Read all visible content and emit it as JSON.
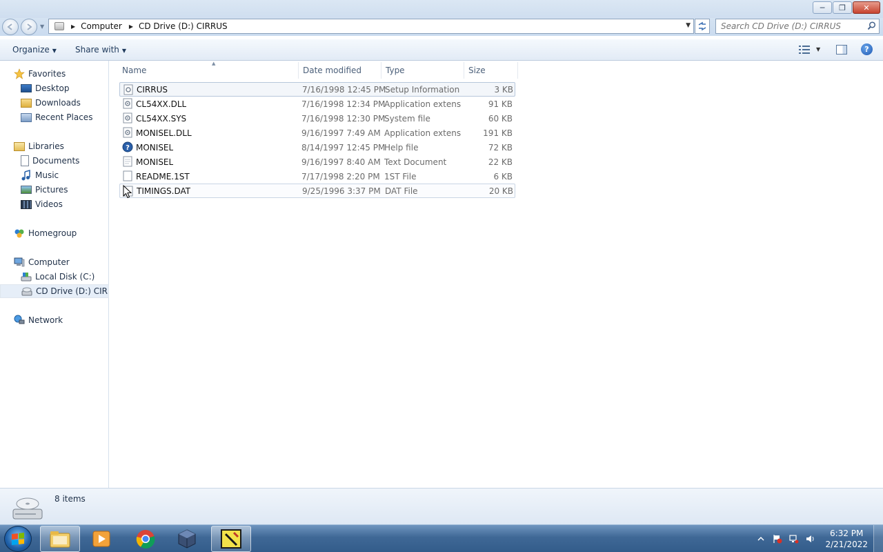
{
  "window": {
    "controls": {
      "minimize": "─",
      "maximize": "❐",
      "close": "✕"
    }
  },
  "address": {
    "crumbs": [
      "Computer",
      "CD Drive (D:) CIRRUS"
    ],
    "search_placeholder": "Search CD Drive (D:) CIRRUS"
  },
  "toolbar": {
    "organize_label": "Organize",
    "share_label": "Share with",
    "help_label": "?"
  },
  "navpane": {
    "favorites": {
      "label": "Favorites",
      "items": [
        "Desktop",
        "Downloads",
        "Recent Places"
      ]
    },
    "libraries": {
      "label": "Libraries",
      "items": [
        "Documents",
        "Music",
        "Pictures",
        "Videos"
      ]
    },
    "homegroup": {
      "label": "Homegroup"
    },
    "computer": {
      "label": "Computer",
      "items": [
        "Local Disk (C:)",
        "CD Drive (D:) CIRRUS"
      ]
    },
    "network": {
      "label": "Network"
    }
  },
  "columns": {
    "name": "Name",
    "date": "Date modified",
    "type": "Type",
    "size": "Size"
  },
  "files": [
    {
      "name": "CIRRUS",
      "date": "7/16/1998 12:45 PM",
      "type": "Setup Information",
      "size": "3 KB",
      "icon": "setup-info-icon"
    },
    {
      "name": "CL54XX.DLL",
      "date": "7/16/1998 12:34 PM",
      "type": "Application extens...",
      "size": "91 KB",
      "icon": "dll-icon"
    },
    {
      "name": "CL54XX.SYS",
      "date": "7/16/1998 12:30 PM",
      "type": "System file",
      "size": "60 KB",
      "icon": "sys-file-icon"
    },
    {
      "name": "MONISEL.DLL",
      "date": "9/16/1997 7:49 AM",
      "type": "Application extens...",
      "size": "191 KB",
      "icon": "dll-icon"
    },
    {
      "name": "MONISEL",
      "date": "8/14/1997 12:45 PM",
      "type": "Help file",
      "size": "72 KB",
      "icon": "help-file-icon"
    },
    {
      "name": "MONISEL",
      "date": "9/16/1997 8:40 AM",
      "type": "Text Document",
      "size": "22 KB",
      "icon": "text-file-icon"
    },
    {
      "name": "README.1ST",
      "date": "7/17/1998 2:20 PM",
      "type": "1ST File",
      "size": "6 KB",
      "icon": "generic-file-icon"
    },
    {
      "name": "TIMINGS.DAT",
      "date": "9/25/1996 3:37 PM",
      "type": "DAT File",
      "size": "20 KB",
      "icon": "generic-file-icon"
    }
  ],
  "status": {
    "items_text": "8 items"
  },
  "taskbar": {
    "clock_time": "6:32 PM",
    "clock_date": "2/21/2022",
    "apps": [
      "windows-explorer-icon",
      "media-player-icon",
      "chrome-icon",
      "virtualbox-icon",
      "tool-app-icon"
    ]
  },
  "colors": {
    "accent": "#1e395b",
    "taskbar": "#3f6896",
    "selection": "#e6eef8"
  }
}
